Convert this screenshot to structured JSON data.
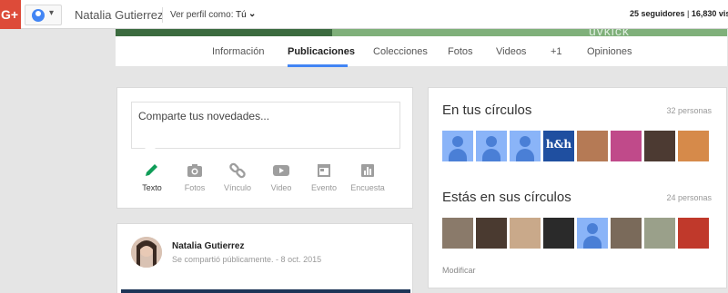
{
  "topbar": {
    "logo": "G+",
    "profile_name": "Natalia Gutierrez",
    "view_as_label": "Ver perfil como:",
    "view_as_value": "Tú",
    "followers": "25 seguidores",
    "stats_separator": " | ",
    "views": "16,830 vis"
  },
  "cover": {
    "brand_text": "uvkick"
  },
  "tabs": [
    {
      "label": "Información"
    },
    {
      "label": "Publicaciones"
    },
    {
      "label": "Colecciones"
    },
    {
      "label": "Fotos"
    },
    {
      "label": "Videos"
    },
    {
      "label": "+1"
    },
    {
      "label": "Opiniones"
    }
  ],
  "share": {
    "placeholder": "Comparte tus novedades...",
    "actions": [
      {
        "label": "Texto",
        "icon": "pencil-icon"
      },
      {
        "label": "Fotos",
        "icon": "camera-icon"
      },
      {
        "label": "Vínculo",
        "icon": "link-icon"
      },
      {
        "label": "Video",
        "icon": "video-icon"
      },
      {
        "label": "Evento",
        "icon": "calendar-icon"
      },
      {
        "label": "Encuesta",
        "icon": "poll-icon"
      }
    ]
  },
  "post": {
    "author": "Natalia Gutierrez",
    "meta": "Se compartió públicamente.  -  8 oct. 2015"
  },
  "circles": {
    "in_your_circles": {
      "title": "En tus círculos",
      "count": "32 personas"
    },
    "in_their_circles": {
      "title": "Estás en sus círculos",
      "count": "24 personas"
    },
    "hh_label": "h&h",
    "modify_label": "Modificar"
  },
  "colors": {
    "gplus_red": "#dd4b39",
    "accent_blue": "#4285f4",
    "pencil_green": "#0f9d58",
    "icon_gray": "#9e9e9e"
  }
}
